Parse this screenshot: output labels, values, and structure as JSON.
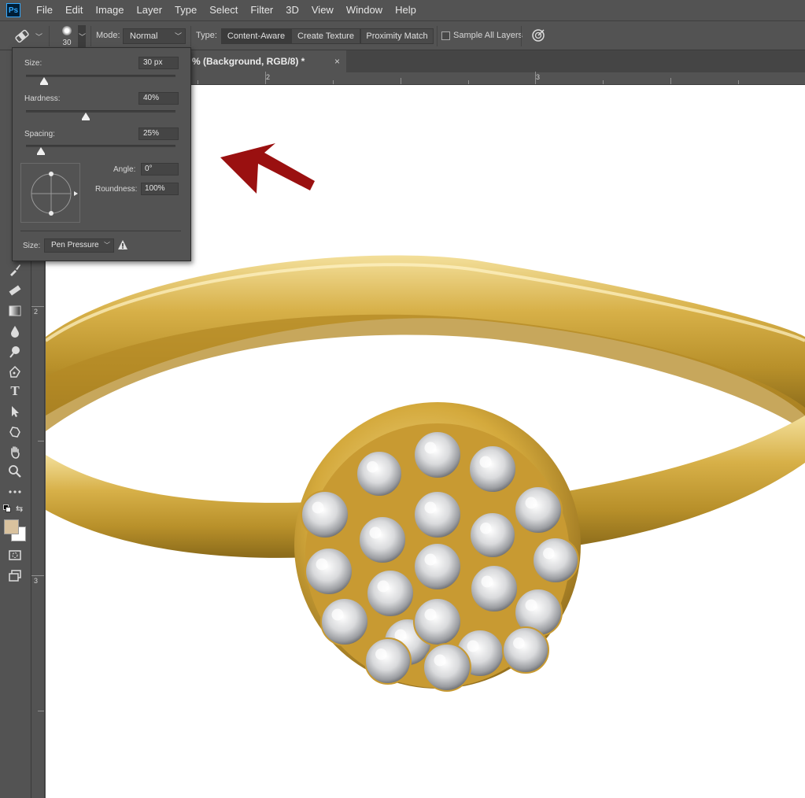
{
  "menu": {
    "logo": "Ps",
    "items": [
      "File",
      "Edit",
      "Image",
      "Layer",
      "Type",
      "Select",
      "Filter",
      "3D",
      "View",
      "Window",
      "Help"
    ]
  },
  "options_bar": {
    "brush_size_preview": "30",
    "mode_label": "Mode:",
    "mode_value": "Normal",
    "type_label": "Type:",
    "type_options": [
      "Content-Aware",
      "Create Texture",
      "Proximity Match"
    ],
    "type_selected": "Content-Aware",
    "sample_all_layers_label": "Sample All Layers",
    "sample_all_layers_checked": false
  },
  "document_tab": {
    "title": "% (Background, RGB/8) *",
    "close": "×"
  },
  "rulers": {
    "horizontal_numbers": [
      "2",
      "3"
    ],
    "vertical_numbers": [
      "2",
      "3"
    ]
  },
  "brush_panel": {
    "size_label": "Size:",
    "size_value": "30 px",
    "size_slider_level": 0.12,
    "hardness_label": "Hardness:",
    "hardness_value": "40%",
    "hardness_slider_level": 0.4,
    "spacing_label": "Spacing:",
    "spacing_value": "25%",
    "spacing_slider_level": 0.1,
    "angle_label": "Angle:",
    "angle_value": "0°",
    "roundness_label": "Roundness:",
    "roundness_value": "100%",
    "pen_size_label": "Size:",
    "pen_size_value": "Pen Pressure"
  },
  "toolbar": {
    "tools": [
      "spot-healing-brush-icon",
      "brush-icon",
      "clone-stamp-icon",
      "history-brush-icon",
      "eraser-icon",
      "gradient-icon",
      "blur-icon",
      "dodge-icon",
      "pen-icon",
      "type-icon",
      "path-selection-icon",
      "shape-icon",
      "hand-icon",
      "zoom-icon",
      "more-tools-icon"
    ],
    "type_tool_glyph": "T",
    "foreground_color": "#d9c29e",
    "background_color": "#ffffff"
  },
  "annotation": {
    "arrow_color": "#9a1010"
  }
}
